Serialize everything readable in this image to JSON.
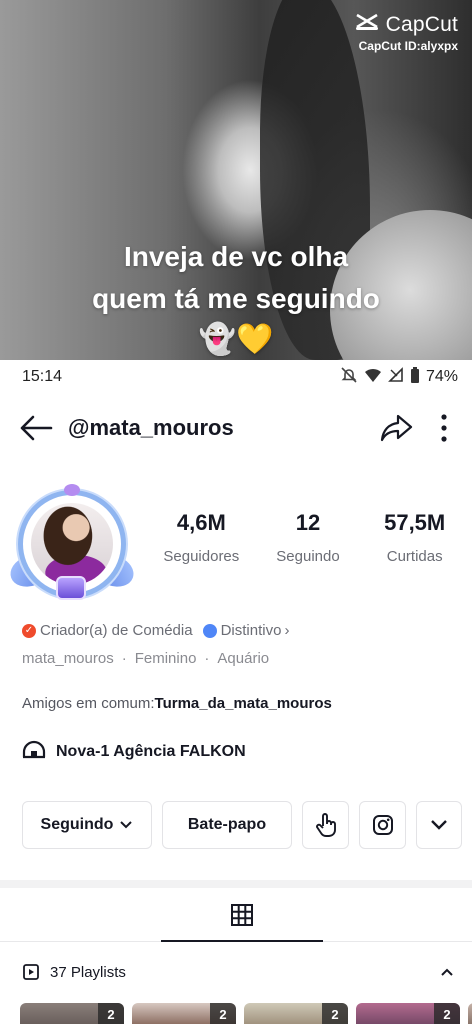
{
  "video": {
    "watermark_brand": "CapCut",
    "watermark_id": "CapCut ID:alyxpx",
    "caption_line1": "Inveja de vc olha",
    "caption_line2": "quem tá me seguindo",
    "caption_emoji": "👻💛"
  },
  "status_bar": {
    "time": "15:14",
    "battery": "74%"
  },
  "header": {
    "username": "@mata_mouros"
  },
  "stats": [
    {
      "value": "4,6M",
      "label": "Seguidores"
    },
    {
      "value": "12",
      "label": "Seguindo"
    },
    {
      "value": "57,5M",
      "label": "Curtidas"
    }
  ],
  "bio": {
    "creator_tag": "Criador(a) de Comédia",
    "badge_tag": "Distintivo",
    "handle": "mata_mouros",
    "gender": "Feminino",
    "sign": "Aquário",
    "friends_prefix": "Amigos em comum:",
    "friends_name": "Turma_da_mata_mouros",
    "agency": "Nova-1 Agência FALKON"
  },
  "actions": {
    "following_label": "Seguindo",
    "chat_label": "Bate-papo"
  },
  "playlists": {
    "label": "37 Playlists",
    "thumb_counts": [
      "2",
      "2",
      "2",
      "2"
    ]
  },
  "colors": {
    "accent_red": "#ef4b2c",
    "badge_blue": "#4f86f7",
    "text_primary": "#161823",
    "text_secondary": "#6b6d75"
  }
}
